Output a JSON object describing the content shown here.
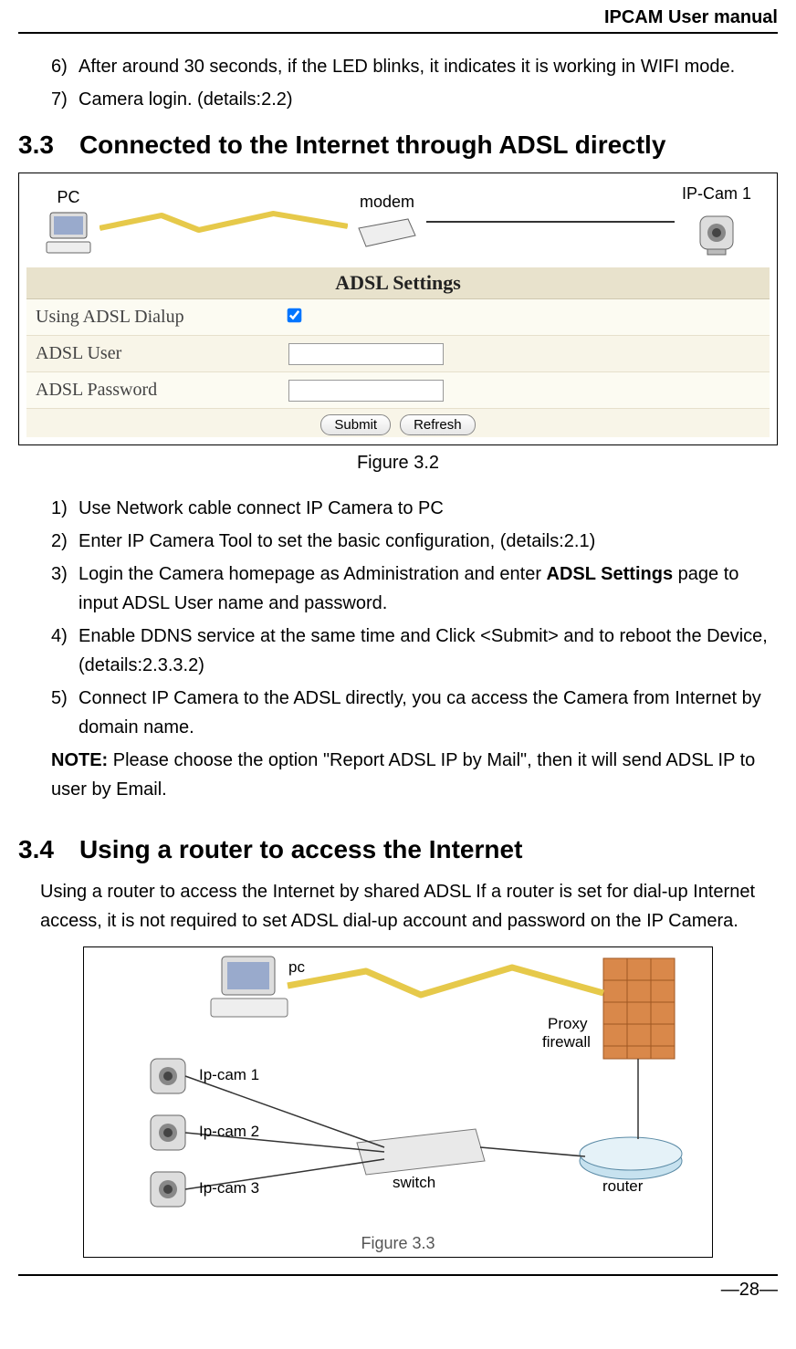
{
  "header": {
    "title": "IPCAM User manual"
  },
  "step_list_a": [
    {
      "num": "6)",
      "text": "After around 30 seconds, if the LED blinks, it indicates it is working in WIFI mode."
    },
    {
      "num": "7)",
      "text": "Camera login. (details:2.2)"
    }
  ],
  "section33": {
    "num": "3.3",
    "title": "Connected to the Internet through ADSL directly"
  },
  "diagram1": {
    "labels": {
      "pc": "PC",
      "modem": "modem",
      "cam": "IP-Cam 1"
    }
  },
  "adsl": {
    "title": "ADSL Settings",
    "rows": {
      "dialup": "Using ADSL Dialup",
      "user": "ADSL User",
      "password": "ADSL Password"
    },
    "buttons": {
      "submit": "Submit",
      "refresh": "Refresh"
    }
  },
  "figure32_caption": "Figure 3.2",
  "step_list_b": [
    {
      "num": "1)",
      "text": "Use Network cable connect IP Camera to PC"
    },
    {
      "num": "2)",
      "text": "Enter IP Camera Tool to set the basic configuration, (details:2.1)"
    },
    {
      "num": "3)",
      "text_pre": "Login the Camera homepage as Administration and enter ",
      "bold": "ADSL Settings",
      "text_post": " page to input ADSL User name and password."
    },
    {
      "num": "4)",
      "text": "Enable DDNS service at the same time and Click <Submit> and to reboot the Device, (details:2.3.3.2)"
    },
    {
      "num": "5)",
      "text": "Connect IP Camera to the ADSL directly, you ca access the Camera from Internet by domain name."
    }
  ],
  "note": {
    "label": "NOTE:",
    "text": " Please choose the option \"Report ADSL IP by Mail\", then it will send ADSL IP to user by Email."
  },
  "section34": {
    "num": "3.4",
    "title": "Using a router to access the Internet"
  },
  "paragraph34": "Using a router to access the Internet by shared ADSL If a router is set for dial-up Internet access, it is not required to set ADSL dial-up account and password on the IP Camera.",
  "diagram2": {
    "labels": {
      "pc": "pc",
      "cam1": "Ip-cam 1",
      "cam2": "Ip-cam 2",
      "cam3": "Ip-cam 3",
      "switch": "switch",
      "router": "router",
      "firewall_l1": "Proxy",
      "firewall_l2": "firewall"
    },
    "caption": "Figure 3.3"
  },
  "footer": {
    "page": "—28—"
  }
}
